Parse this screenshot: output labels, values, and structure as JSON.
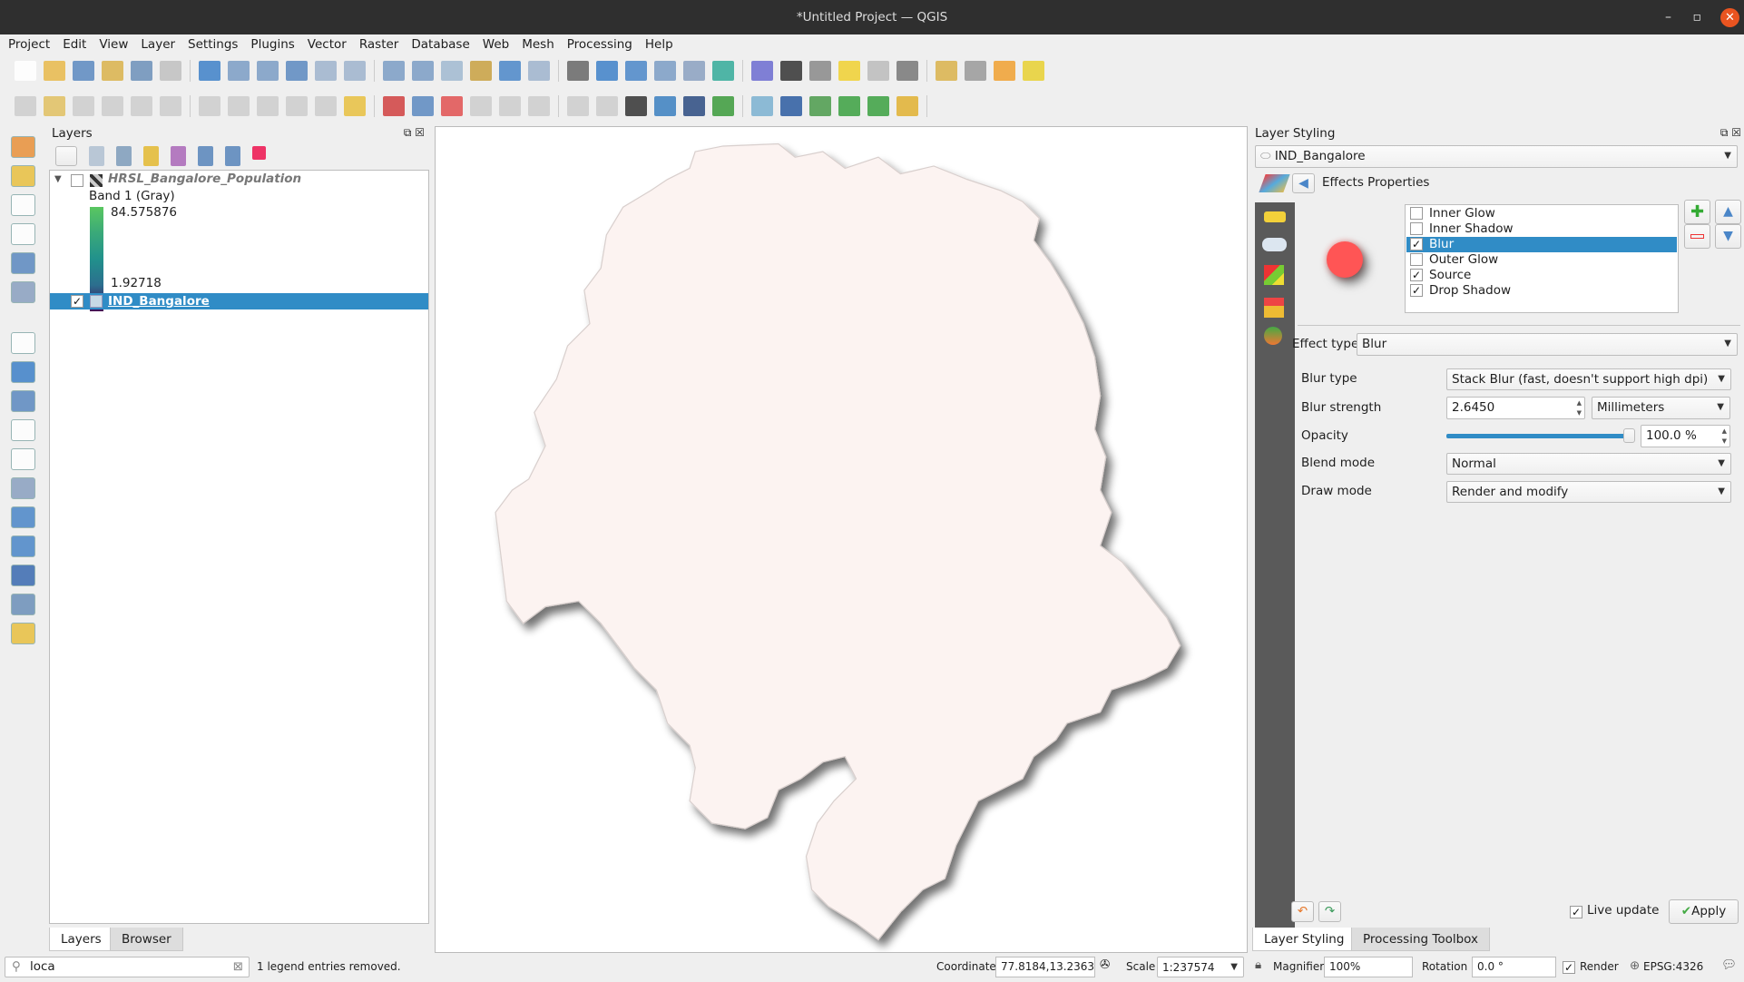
{
  "window": {
    "title": "*Untitled Project — QGIS",
    "minimize": "–",
    "maximize": "▫",
    "close": "✕"
  },
  "menu": [
    "Project",
    "Edit",
    "View",
    "Layer",
    "Settings",
    "Plugins",
    "Vector",
    "Raster",
    "Database",
    "Web",
    "Mesh",
    "Processing",
    "Help"
  ],
  "layers_panel": {
    "title": "Layers",
    "layers": [
      {
        "name": "HRSL_Bangalore_Population",
        "checked": false,
        "band": "Band 1 (Gray)",
        "max": "84.575876",
        "min": "1.92718"
      },
      {
        "name": "IND_Bangalore",
        "checked": true,
        "selected": true
      }
    ],
    "tabs": [
      "Layers",
      "Browser"
    ]
  },
  "styling_panel": {
    "title": "Layer Styling",
    "layer": "IND_Bangalore",
    "header": "Effects Properties",
    "effects": [
      {
        "label": "Inner Glow",
        "checked": false
      },
      {
        "label": "Inner Shadow",
        "checked": false
      },
      {
        "label": "Blur",
        "checked": true,
        "selected": true
      },
      {
        "label": "Outer Glow",
        "checked": false
      },
      {
        "label": "Source",
        "checked": true
      },
      {
        "label": "Drop Shadow",
        "checked": true
      }
    ],
    "effect_type_label": "Effect type",
    "effect_type": "Blur",
    "blur_type_label": "Blur type",
    "blur_type": "Stack Blur (fast, doesn't support high dpi)",
    "blur_strength_label": "Blur strength",
    "blur_strength": "2.6450",
    "blur_unit": "Millimeters",
    "opacity_label": "Opacity",
    "opacity": "100.0 %",
    "opacity_fraction": 1.0,
    "blend_mode_label": "Blend mode",
    "blend_mode": "Normal",
    "draw_mode_label": "Draw mode",
    "draw_mode": "Render and modify",
    "live_update": "Live update",
    "apply": "Apply",
    "tabs": [
      "Layer Styling",
      "Processing Toolbox"
    ],
    "preview_color": "#ff5555"
  },
  "map": {
    "fill": "#fcf3f1",
    "stroke": "#d8cfcd"
  },
  "status": {
    "search": "loca",
    "message": "1 legend entries removed.",
    "coordinate_label": "Coordinate",
    "coordinate": "77.8184,13.2363",
    "scale_label": "Scale",
    "scale": "1:237574",
    "magnifier_label": "Magnifier",
    "magnifier": "100%",
    "rotation_label": "Rotation",
    "rotation": "0.0 °",
    "render": "Render",
    "crs": "EPSG:4326"
  }
}
